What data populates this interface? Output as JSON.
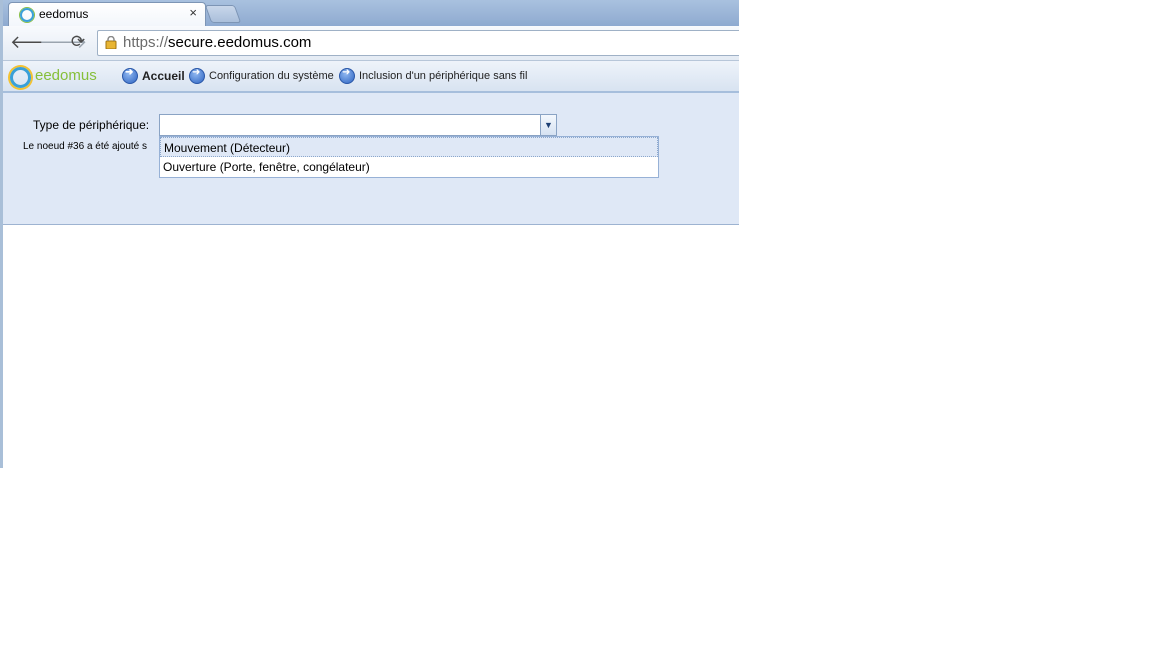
{
  "browser": {
    "tab_title": "eedomus",
    "tab_close": "×",
    "url_scheme": "https://",
    "url_host": "secure.eedomus.com"
  },
  "app": {
    "logo_text": "eedomus",
    "nav": [
      {
        "label": "Accueil"
      },
      {
        "label": "Configuration du système"
      },
      {
        "label": "Inclusion d'un périphérique sans fil"
      }
    ]
  },
  "form": {
    "type_label": "Type de périphérique:",
    "message": "Le noeud #36 a été ajouté s",
    "select_value": "",
    "options": [
      {
        "label": "Mouvement (Détecteur)"
      },
      {
        "label": "Ouverture (Porte, fenêtre, congélateur)"
      }
    ]
  },
  "colors": {
    "accent": "#3aa0d8",
    "logo_green": "#86bf3a",
    "content_bg": "#dfe8f6"
  }
}
